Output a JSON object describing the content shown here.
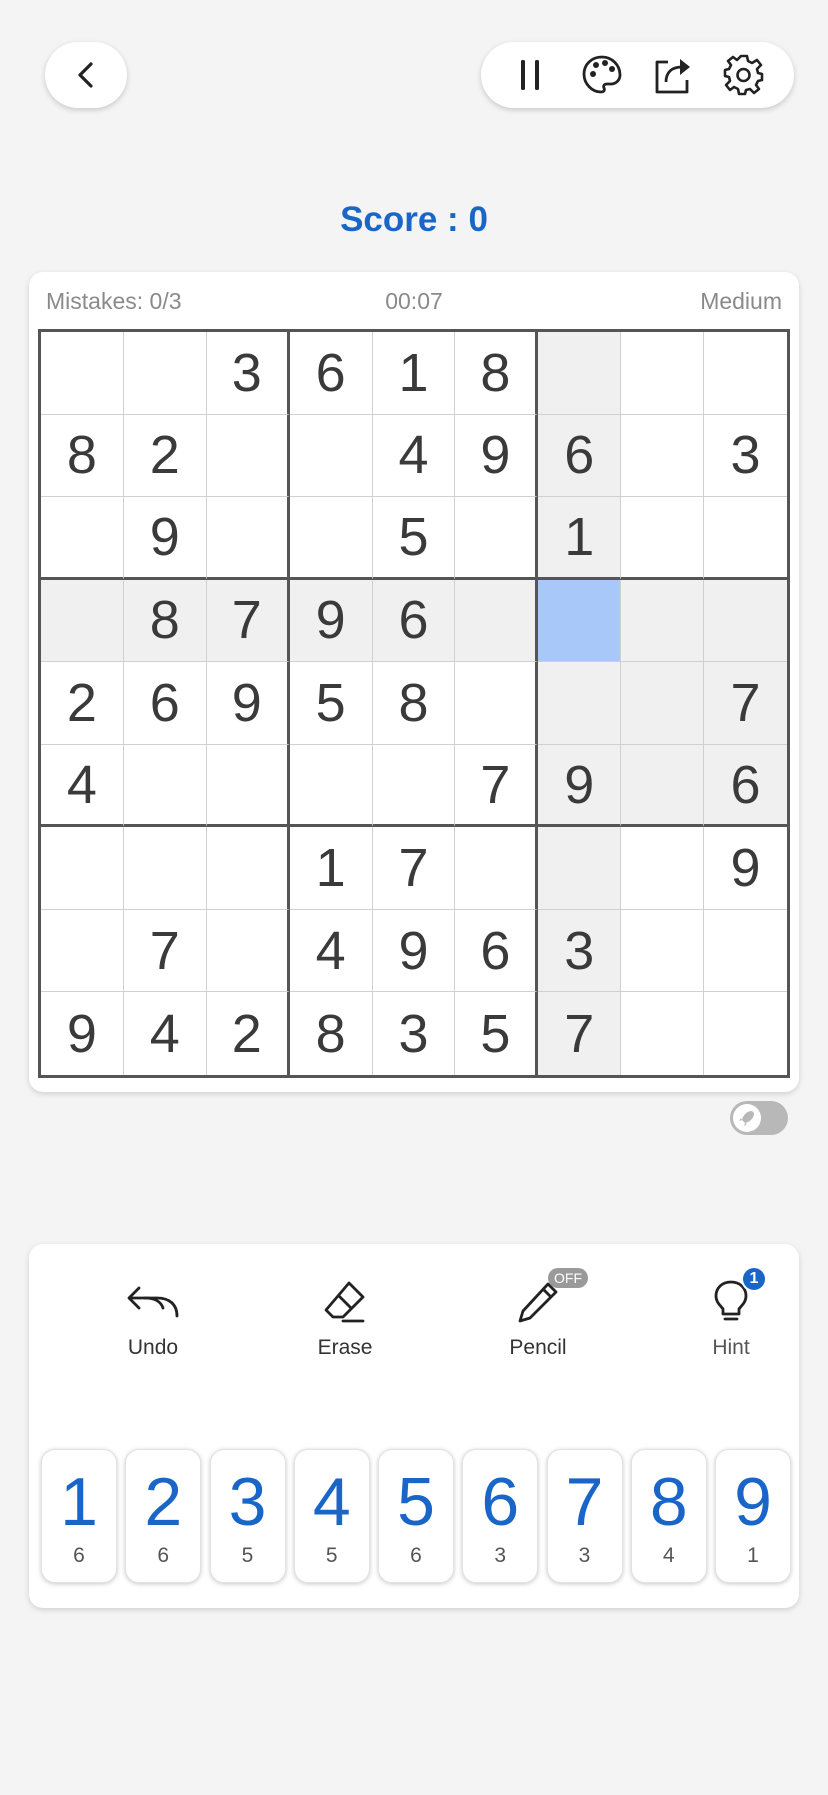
{
  "score_label": "Score : 0",
  "status": {
    "mistakes": "Mistakes: 0/3",
    "timer": "00:07",
    "difficulty": "Medium"
  },
  "board": [
    [
      "",
      "",
      "3",
      "6",
      "1",
      "8",
      "",
      "",
      ""
    ],
    [
      "8",
      "2",
      "",
      "",
      "4",
      "9",
      "6",
      "",
      "3"
    ],
    [
      "",
      "9",
      "",
      "",
      "5",
      "",
      "1",
      "",
      ""
    ],
    [
      "",
      "8",
      "7",
      "9",
      "6",
      "",
      "",
      "",
      ""
    ],
    [
      "2",
      "6",
      "9",
      "5",
      "8",
      "",
      "",
      "",
      "7"
    ],
    [
      "4",
      "",
      "",
      "",
      "",
      "7",
      "9",
      "",
      "6"
    ],
    [
      "",
      "",
      "",
      "1",
      "7",
      "",
      "",
      "",
      "9"
    ],
    [
      "",
      "7",
      "",
      "4",
      "9",
      "6",
      "3",
      "",
      ""
    ],
    [
      "9",
      "4",
      "2",
      "8",
      "3",
      "5",
      "7",
      "",
      ""
    ]
  ],
  "selected_cell": {
    "row": 3,
    "col": 6
  },
  "colors": {
    "accent": "#1a66c8",
    "selected": "#a8c8fa",
    "highlight": "#f0f0f0"
  },
  "actions": [
    {
      "label": "Undo",
      "icon": "undo-icon"
    },
    {
      "label": "Erase",
      "icon": "eraser-icon"
    },
    {
      "label": "Pencil",
      "icon": "pencil-icon",
      "badge": "OFF"
    },
    {
      "label": "Hint",
      "icon": "lightbulb-icon",
      "badge": "1"
    }
  ],
  "numpad": [
    {
      "digit": "1",
      "remaining": "6"
    },
    {
      "digit": "2",
      "remaining": "6"
    },
    {
      "digit": "3",
      "remaining": "5"
    },
    {
      "digit": "4",
      "remaining": "5"
    },
    {
      "digit": "5",
      "remaining": "6"
    },
    {
      "digit": "6",
      "remaining": "3"
    },
    {
      "digit": "7",
      "remaining": "3"
    },
    {
      "digit": "8",
      "remaining": "4"
    },
    {
      "digit": "9",
      "remaining": "1"
    }
  ],
  "toolbar_icons": [
    "pause-icon",
    "palette-icon",
    "share-icon",
    "gear-icon"
  ],
  "toggle_icon": "rocket-icon"
}
